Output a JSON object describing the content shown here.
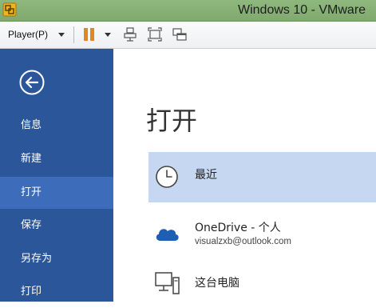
{
  "window": {
    "title": "Windows 10 - VMware"
  },
  "toolbar": {
    "player_label": "Player(P)"
  },
  "sidebar": {
    "items": [
      {
        "label": "信息",
        "active": false
      },
      {
        "label": "新建",
        "active": false
      },
      {
        "label": "打开",
        "active": true
      },
      {
        "label": "保存",
        "active": false
      },
      {
        "label": "另存为",
        "active": false
      },
      {
        "label": "打印",
        "active": false
      }
    ]
  },
  "main": {
    "title": "打开",
    "locations": [
      {
        "label": "最近",
        "icon": "clock-icon",
        "selected": true
      },
      {
        "label": "OneDrive - 个人",
        "sublabel": "visualzxb@outlook.com",
        "icon": "cloud-icon",
        "selected": false
      },
      {
        "label": "这台电脑",
        "icon": "computer-icon",
        "selected": false
      }
    ]
  },
  "colors": {
    "sidebar_bg": "#2b579a",
    "sidebar_active": "#3c6cba",
    "selected_location": "#c5d7f1",
    "vmware_titlebar": "#8fb87e",
    "pause_orange": "#e0881d"
  }
}
